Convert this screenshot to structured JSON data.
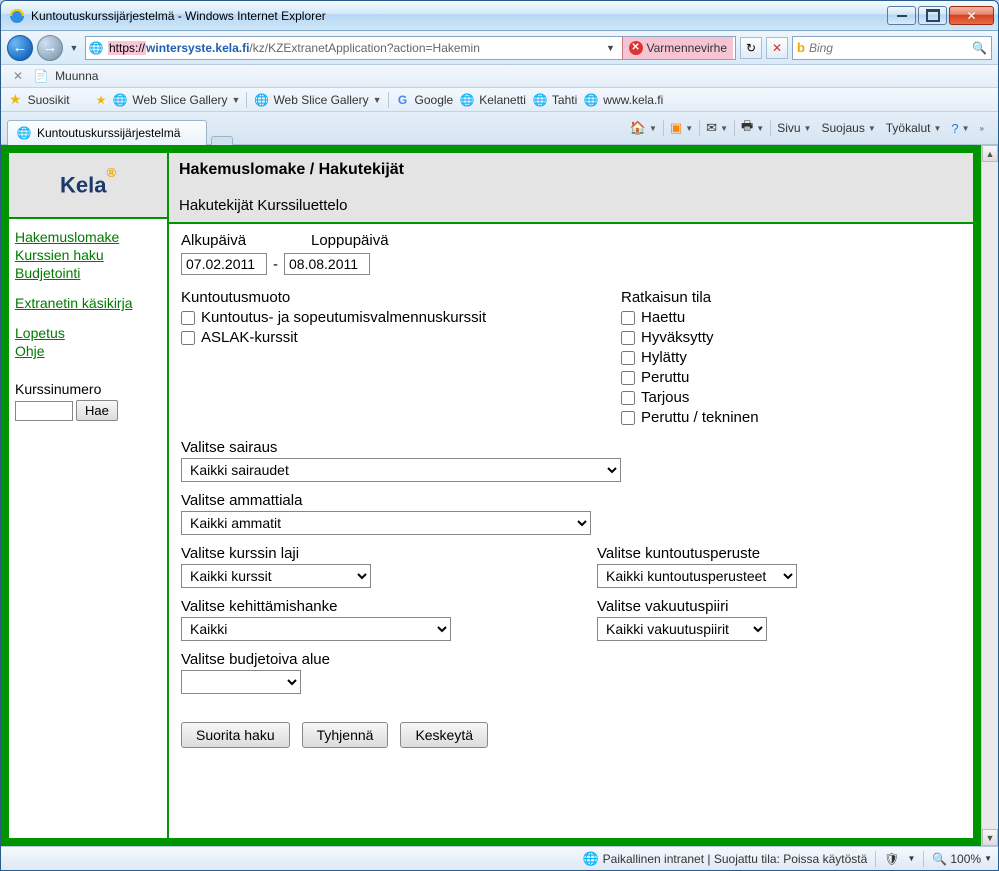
{
  "window": {
    "title": "Kuntoutuskurssijärjestelmä - Windows Internet Explorer"
  },
  "nav": {
    "url_proto": "https://",
    "url_host": "wintersyste.kela.fi",
    "url_path": "/kz/KZExtranetApplication?action=Hakemin",
    "cert_error": "Varmennevirhe",
    "search_placeholder": "Bing"
  },
  "muunna_row": {
    "label": "Muunna"
  },
  "fav_row": {
    "suosikit": "Suosikit",
    "links": [
      "Web Slice Gallery",
      "Web Slice Gallery",
      "Google",
      "Kelanetti",
      "Tahti",
      "www.kela.fi"
    ]
  },
  "tab": {
    "title": "Kuntoutuskurssijärjestelmä"
  },
  "cmdbar": {
    "sivu": "Sivu",
    "suojaus": "Suojaus",
    "tyokalut": "Työkalut"
  },
  "logo": "Kela",
  "sidebar": {
    "links1": [
      "Hakemuslomake",
      "Kurssien haku",
      "Budjetointi"
    ],
    "links2": [
      "Extranetin käsikirja"
    ],
    "links3": [
      "Lopetus",
      "Ohje"
    ],
    "kurssinumero_label": "Kurssinumero",
    "hae_btn": "Hae"
  },
  "header": {
    "title": "Hakemuslomake / Hakutekijät",
    "tabs": "Hakutekijät Kurssiluettelo"
  },
  "form": {
    "alkupaiva_label": "Alkupäivä",
    "loppupaiva_label": "Loppupäivä",
    "alkupaiva": "07.02.2011",
    "loppupaiva": "08.08.2011",
    "kuntoutusmuoto_label": "Kuntoutusmuoto",
    "kuntoutusmuoto_opts": [
      "Kuntoutus- ja sopeutumisvalmennuskurssit",
      "ASLAK-kurssit"
    ],
    "ratkaisun_tila_label": "Ratkaisun tila",
    "ratkaisun_tila_opts": [
      "Haettu",
      "Hyväksytty",
      "Hylätty",
      "Peruttu",
      "Tarjous",
      "Peruttu / tekninen"
    ],
    "valitse_sairaus": "Valitse sairaus",
    "sairaus_val": "Kaikki sairaudet",
    "valitse_ammattiala": "Valitse ammattiala",
    "ammattiala_val": "Kaikki ammatit",
    "valitse_kurssin_laji": "Valitse kurssin laji",
    "kurssin_laji_val": "Kaikki kurssit",
    "valitse_kuntoutusperuste": "Valitse kuntoutusperuste",
    "kuntoutusperuste_val": "Kaikki kuntoutusperusteet",
    "valitse_kehittamishanke": "Valitse kehittämishanke",
    "kehittamishanke_val": "Kaikki",
    "valitse_vakuutuspiiri": "Valitse vakuutuspiiri",
    "vakuutuspiiri_val": "Kaikki vakuutuspiirit",
    "valitse_budjetoiva_alue": "Valitse budjetoiva alue",
    "budjetoiva_alue_val": "",
    "btn_suorita": "Suorita haku",
    "btn_tyhjenna": "Tyhjennä",
    "btn_keskeyta": "Keskeytä"
  },
  "status": {
    "zone": "Paikallinen intranet | Suojattu tila: Poissa käytöstä",
    "zoom": "100%"
  }
}
